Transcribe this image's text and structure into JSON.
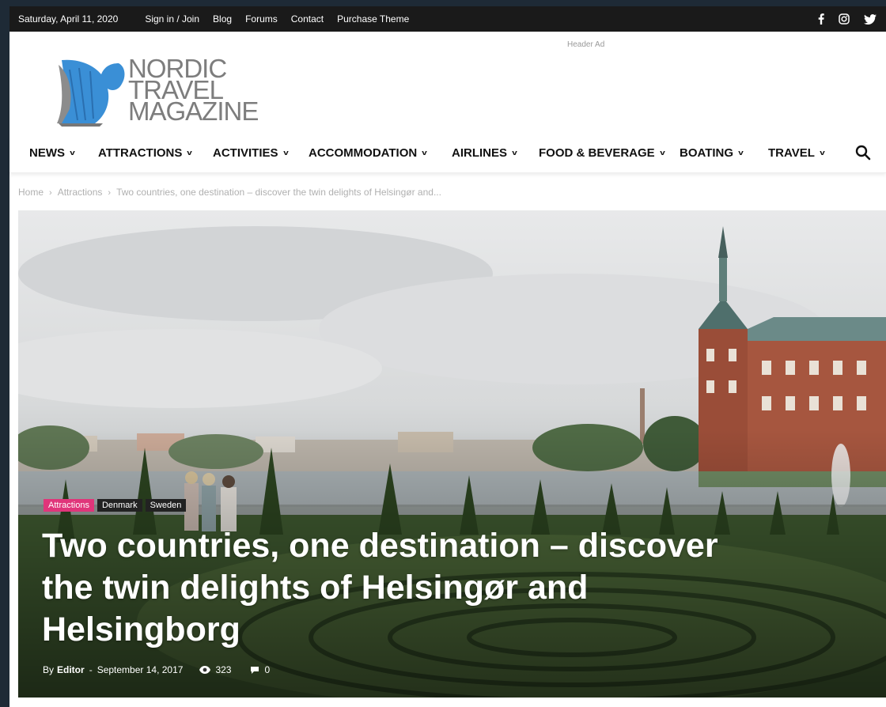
{
  "topbar": {
    "date": "Saturday, April 11, 2020",
    "links": [
      "Sign in / Join",
      "Blog",
      "Forums",
      "Contact",
      "Purchase Theme"
    ],
    "social_icons": [
      "facebook-icon",
      "instagram-icon",
      "twitter-icon"
    ]
  },
  "header": {
    "ad_label": "Header Ad",
    "logo_lines": [
      "NORDIC",
      "TRAVEL",
      "MAGAZINE"
    ],
    "logo_color": "#3a8fd6"
  },
  "menu": {
    "items": [
      "NEWS",
      "ATTRACTIONS",
      "ACTIVITIES",
      "ACCOMMODATION",
      "AIRLINES",
      "FOOD & BEVERAGE",
      "BOATING",
      "TRAVEL"
    ],
    "search_icon": "search-icon"
  },
  "breadcrumb": {
    "home": "Home",
    "category": "Attractions",
    "current": "Two countries, one destination – discover the twin delights of Helsingør and..."
  },
  "article": {
    "tags": [
      "Attractions",
      "Denmark",
      "Sweden"
    ],
    "title": "Two countries, one destination – discover the twin delights of Helsingør and Helsingborg",
    "by": "By",
    "author": "Editor",
    "date": "September 14, 2017",
    "views": "323",
    "comments": "0",
    "accent_color": "#e0357a"
  }
}
